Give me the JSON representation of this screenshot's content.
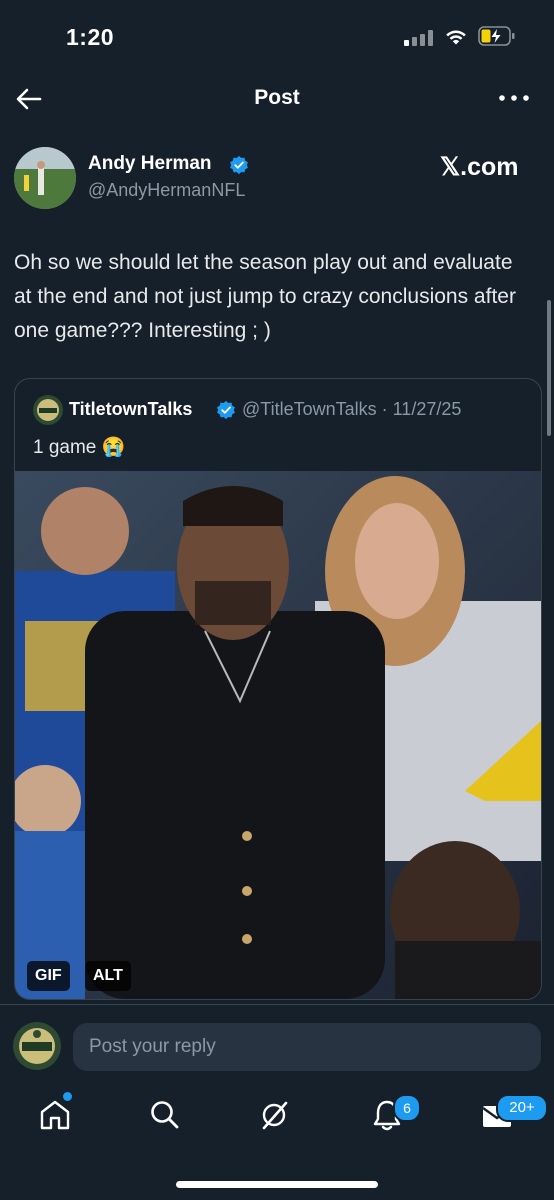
{
  "status_bar": {
    "time": "1:20"
  },
  "header": {
    "title": "Post"
  },
  "post": {
    "author_name": "Andy Herman",
    "author_handle": "@AndyHermanNFL",
    "source": "𝕏.com",
    "text": "Oh so we should let the season play out and evaluate at the end and not just jump to crazy conclusions after one game??? Interesting ; )"
  },
  "quote": {
    "author_name": "TitletownTalks",
    "meta": "@TitleTownTalks · 11/27/25",
    "text": "1 game 😭",
    "badges": {
      "gif": "GIF",
      "alt": "ALT"
    }
  },
  "reply": {
    "placeholder": "Post your reply"
  },
  "tab_bar": {
    "icons": [
      "home-icon",
      "search-icon",
      "grok-icon",
      "notifications-icon",
      "messages-icon"
    ],
    "notifications_count": "6",
    "messages_count": "20+"
  },
  "colors": {
    "background": "#15202b",
    "accent": "#1d9bf0",
    "muted": "#8b98a5",
    "border": "#38444d"
  }
}
